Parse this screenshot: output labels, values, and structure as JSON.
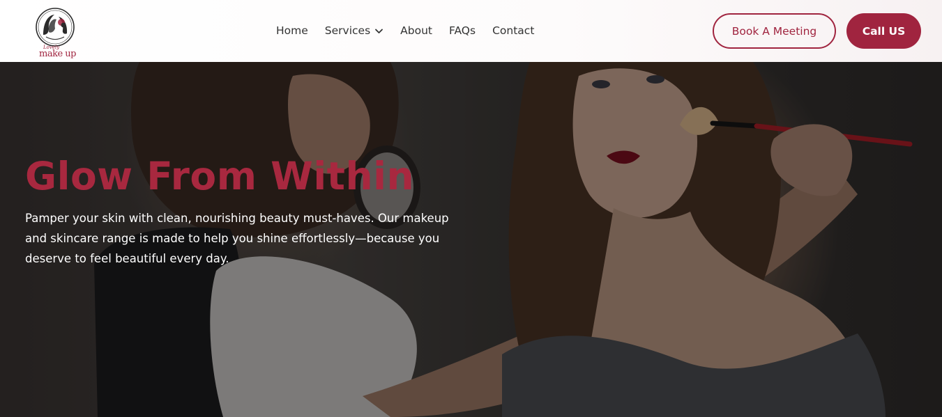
{
  "brand": {
    "logo_text": "make up",
    "logo_script": "Lovely",
    "accent_color": "#a0243f"
  },
  "nav": {
    "items": [
      {
        "label": "Home"
      },
      {
        "label": "Services",
        "has_dropdown": true
      },
      {
        "label": "About"
      },
      {
        "label": "FAQs"
      },
      {
        "label": "Contact"
      }
    ],
    "dropdown_icon": "chevron-down-icon"
  },
  "actions": {
    "book_label": "Book A Meeting",
    "call_label": "Call US"
  },
  "hero": {
    "title": "Glow From Within",
    "description": "Pamper your skin with clean, nourishing beauty must-haves. Our makeup and skincare range is made to help you shine effortlessly—because you deserve to feel beautiful every day."
  }
}
